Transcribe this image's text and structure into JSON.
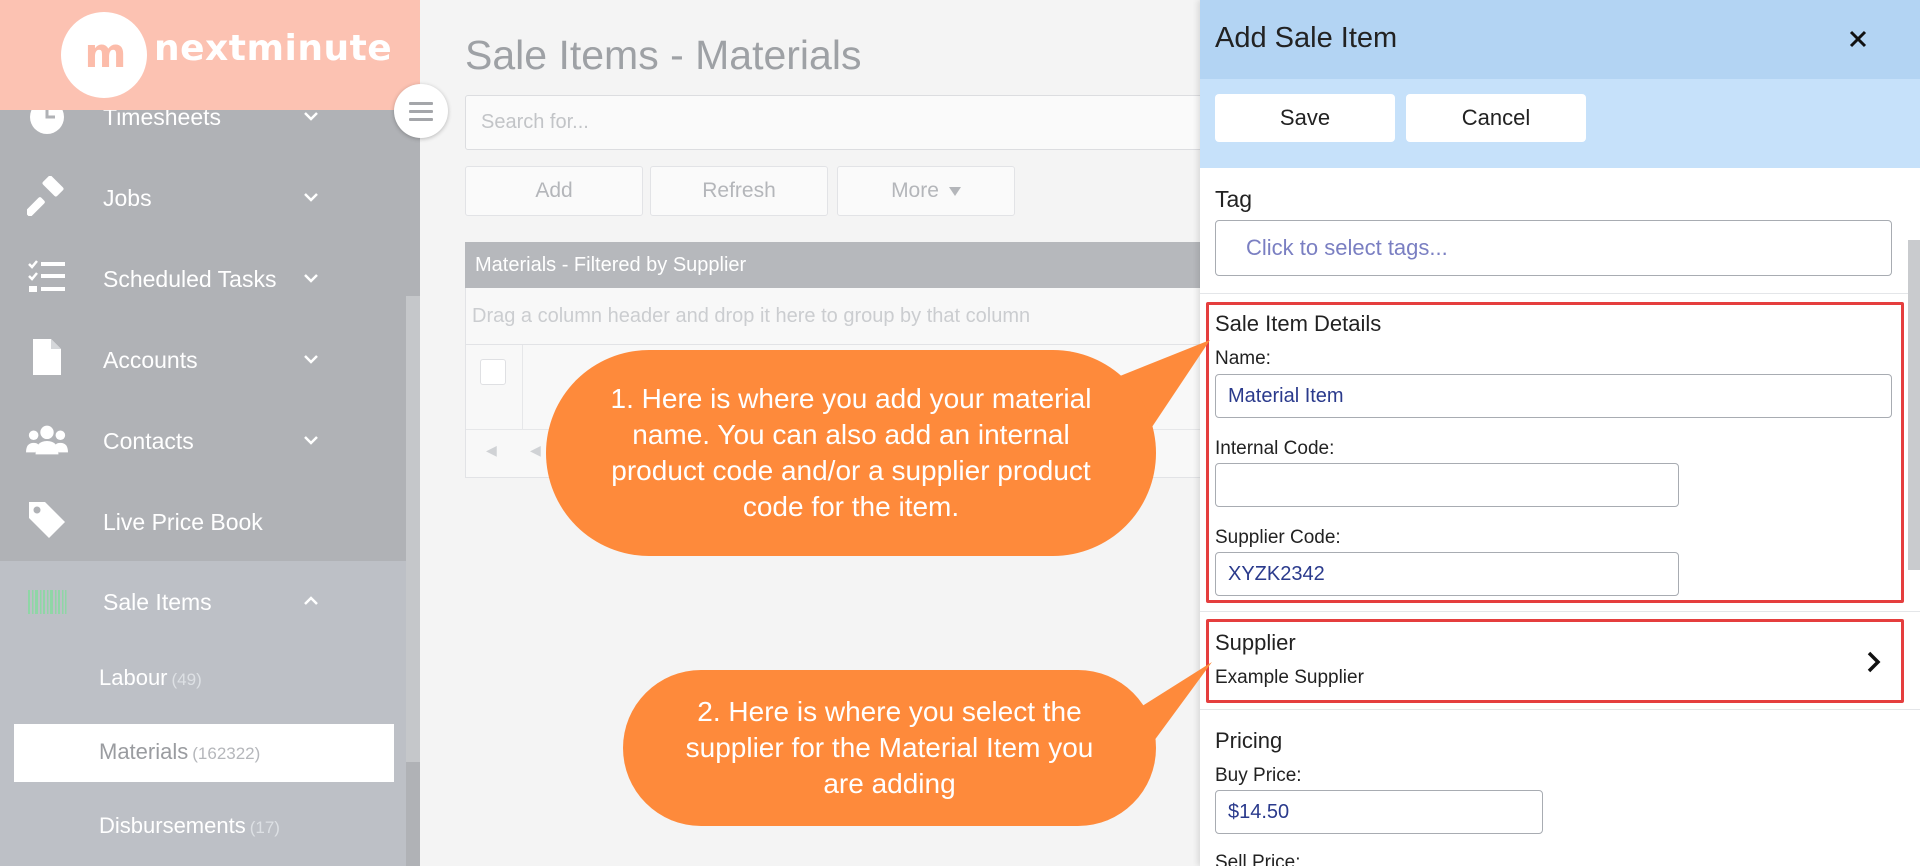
{
  "brand": {
    "logo_mark": "m",
    "logo_text": "nextminute",
    "brand_color": "#fcc2b2"
  },
  "sidebar": {
    "items": [
      {
        "id": "timesheets",
        "label": "Timesheets",
        "icon": "clock-icon"
      },
      {
        "id": "jobs",
        "label": "Jobs",
        "icon": "hammer-icon"
      },
      {
        "id": "scheduled_tasks",
        "label": "Scheduled Tasks",
        "icon": "checklist-icon"
      },
      {
        "id": "accounts",
        "label": "Accounts",
        "icon": "document-icon"
      },
      {
        "id": "contacts",
        "label": "Contacts",
        "icon": "people-icon"
      },
      {
        "id": "live_price_book",
        "label": "Live Price Book",
        "icon": "tag-icon"
      },
      {
        "id": "sale_items",
        "label": "Sale Items",
        "icon": "barcode-icon"
      }
    ],
    "sub_items": [
      {
        "label": "Labour",
        "count": "(49)"
      },
      {
        "label": "Materials",
        "count": "(162322)",
        "active": true
      },
      {
        "label": "Disbursements",
        "count": "(17)"
      }
    ]
  },
  "main": {
    "title": "Sale Items - Materials",
    "search_placeholder": "Search for...",
    "toolbar": {
      "add": "Add",
      "refresh": "Refresh",
      "more": "More"
    },
    "grid": {
      "title": "Materials - Filtered by Supplier",
      "group_hint": "Drag a column header and drop it here to group by that column"
    }
  },
  "callouts": {
    "one": "1. Here is where you add your material name. You can also add an internal product code and/or a supplier product code for the item.",
    "two": "2. Here is where you select the supplier for the Material Item you are adding",
    "color": "#fe8a3b"
  },
  "panel": {
    "title": "Add Sale Item",
    "save": "Save",
    "cancel": "Cancel",
    "tag_label": "Tag",
    "tag_placeholder": "Click to select tags...",
    "details_heading": "Sale Item Details",
    "name_label": "Name:",
    "name_value": "Material Item",
    "internal_code_label": "Internal Code:",
    "internal_code_value": "",
    "supplier_code_label": "Supplier Code:",
    "supplier_code_value": "XYZK2342",
    "supplier_heading": "Supplier",
    "supplier_value": "Example Supplier",
    "pricing_heading": "Pricing",
    "buy_price_label": "Buy Price:",
    "buy_price_value": "$14.50",
    "sell_price_label": "Sell Price:",
    "highlight_color": "#e53e3e",
    "header_color": "#b3d4f3"
  }
}
